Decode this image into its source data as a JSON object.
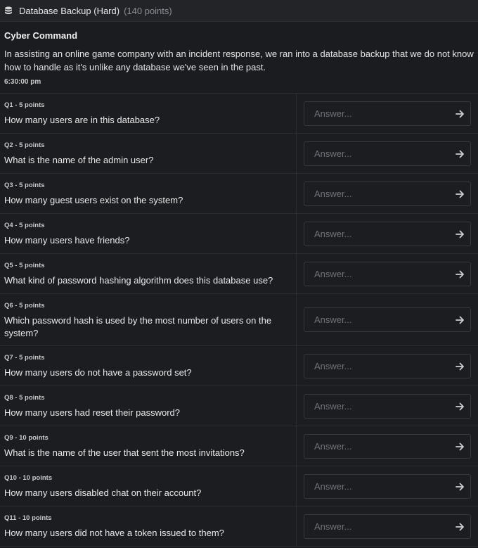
{
  "header": {
    "icon": "database-icon",
    "title": "Database Backup (Hard)",
    "points": "(140 points)"
  },
  "intro": {
    "author": "Cyber Command",
    "description": "In assisting an online game company with an incident response, we ran into a database backup that we do not know how to handle as it's unlike any database we've seen in the past.",
    "time": "6:30:00 pm"
  },
  "answer_placeholder": "Answer...",
  "submit_icon": "arrow-right-icon",
  "questions": [
    {
      "meta": "Q1 - 5 points",
      "text": "How many users are in this database?"
    },
    {
      "meta": "Q2 - 5 points",
      "text": "What is the name of the admin user?"
    },
    {
      "meta": "Q3 - 5 points",
      "text": "How many guest users exist on the system?"
    },
    {
      "meta": "Q4 - 5 points",
      "text": "How many users have friends?"
    },
    {
      "meta": "Q5 - 5 points",
      "text": "What kind of password hashing algorithm does this database use?"
    },
    {
      "meta": "Q6 - 5 points",
      "text": "Which password hash is used by the most number of users on the system?"
    },
    {
      "meta": "Q7 - 5 points",
      "text": "How many users do not have a password set?"
    },
    {
      "meta": "Q8 - 5 points",
      "text": "How many users had reset their password?"
    },
    {
      "meta": "Q9 - 10 points",
      "text": "What is the name of the user that sent the most invitations?"
    },
    {
      "meta": "Q10 - 10 points",
      "text": "How many users disabled chat on their account?"
    },
    {
      "meta": "Q11 - 10 points",
      "text": "How many users did not have a token issued to them?"
    }
  ]
}
